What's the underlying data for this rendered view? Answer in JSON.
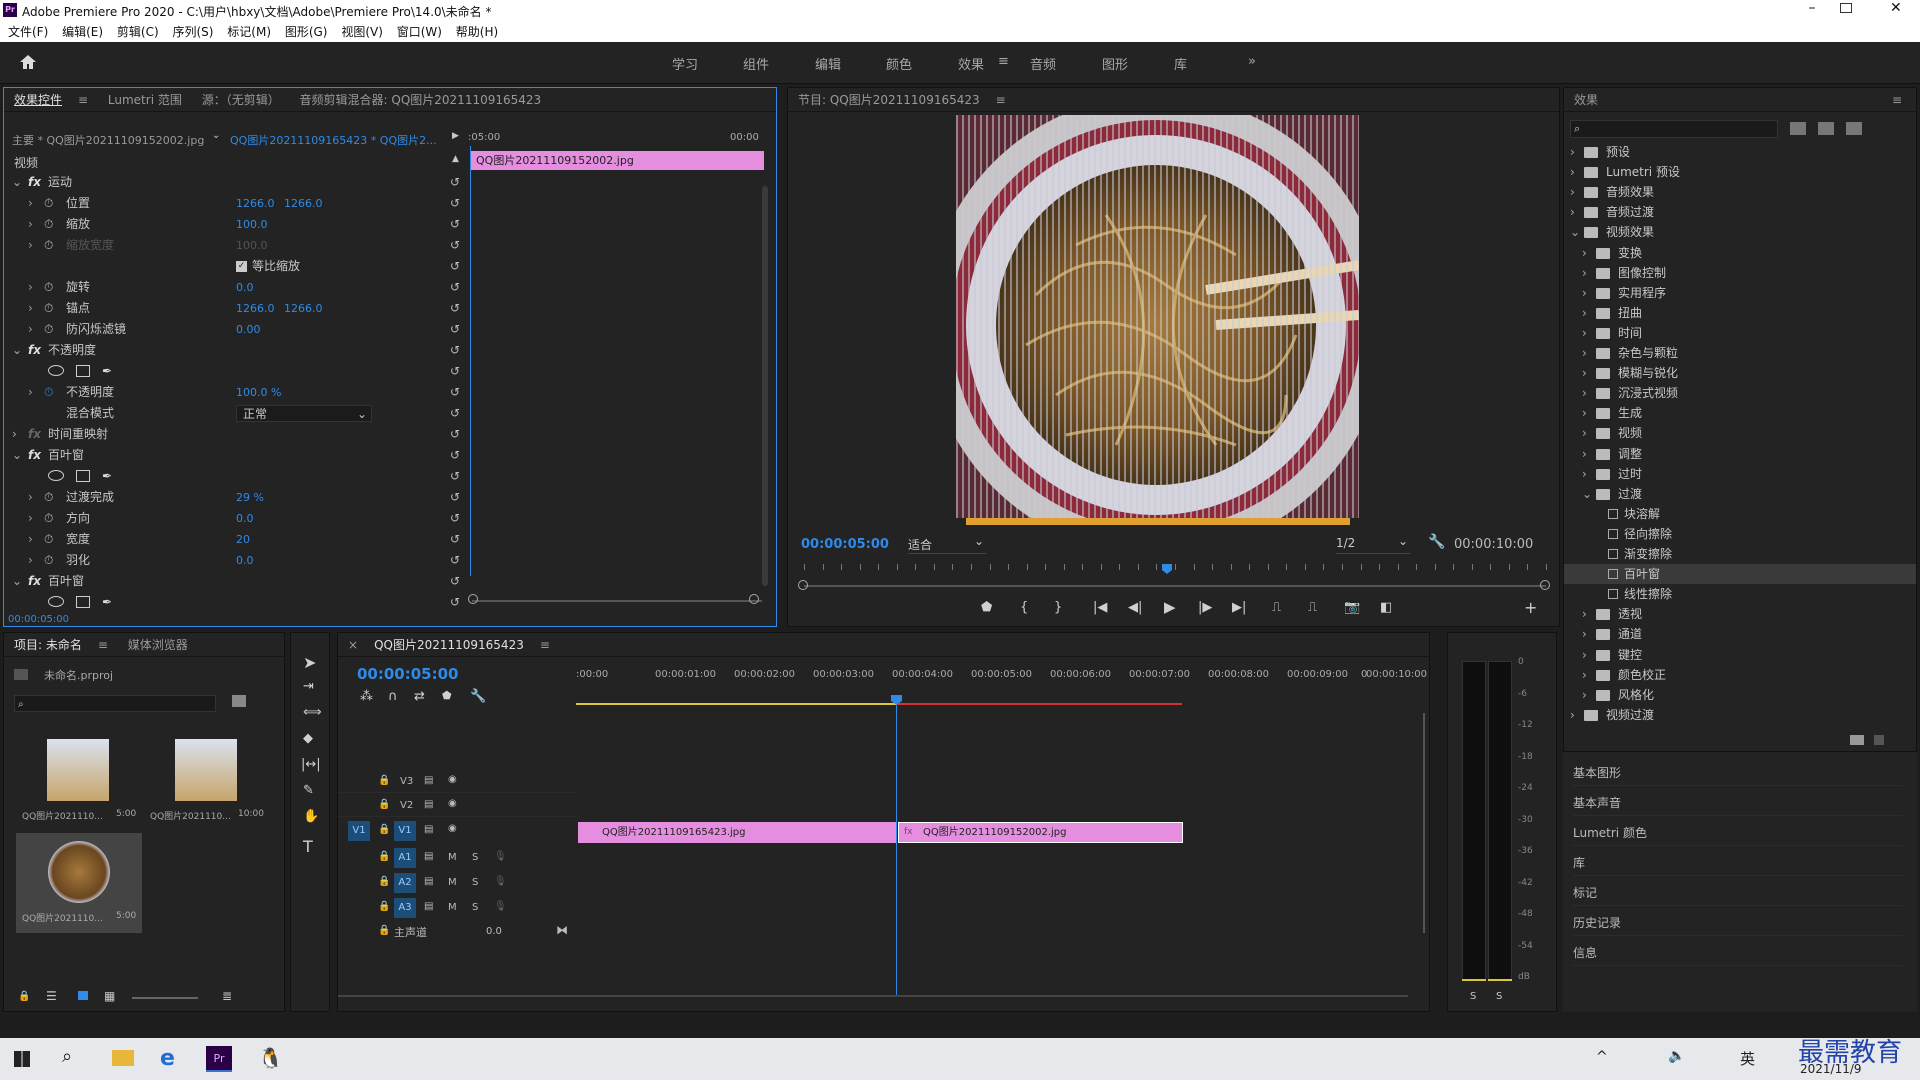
{
  "app": {
    "title": "Adobe Premiere Pro 2020 - C:\\用户\\hbxy\\文档\\Adobe\\Premiere Pro\\14.0\\未命名 *",
    "icon": "Pr"
  },
  "menu": [
    "文件(F)",
    "编辑(E)",
    "剪辑(C)",
    "序列(S)",
    "标记(M)",
    "图形(G)",
    "视图(V)",
    "窗口(W)",
    "帮助(H)"
  ],
  "workspaces": [
    "学习",
    "组件",
    "编辑",
    "颜色",
    "效果",
    "音频",
    "图形",
    "库"
  ],
  "active_workspace": "效果",
  "effect_controls": {
    "tabs": [
      "效果控件",
      "Lumetri 范围",
      "源：（无剪辑）",
      "音频剪辑混合器: QQ图片20211109165423"
    ],
    "master": "主要 * QQ图片20211109152002.jpg",
    "sequence_clip": "QQ图片20211109165423 * QQ图片2...",
    "timecode_start": "00:00",
    "timecode_mid": ":05:00",
    "timecode_end": "00:00",
    "clip_bar_label": "QQ图片20211109152002.jpg",
    "section_video": "视频",
    "rows": [
      {
        "name": "运动",
        "kind": "fx"
      },
      {
        "name": "位置",
        "v1": "1266.0",
        "v2": "1266.0"
      },
      {
        "name": "缩放",
        "v1": "100.0"
      },
      {
        "name": "缩放宽度",
        "v1": "100.0",
        "disabled": true
      },
      {
        "name": "等比缩放",
        "kind": "check"
      },
      {
        "name": "旋转",
        "v1": "0.0"
      },
      {
        "name": "锚点",
        "v1": "1266.0",
        "v2": "1266.0"
      },
      {
        "name": "防闪烁滤镜",
        "v1": "0.00"
      },
      {
        "name": "不透明度",
        "kind": "fx"
      },
      {
        "name": "",
        "kind": "masks"
      },
      {
        "name": "不透明度",
        "v1": "100.0 %"
      },
      {
        "name": "混合模式",
        "kind": "select",
        "v1": "正常"
      },
      {
        "name": "时间重映射",
        "kind": "fx-off"
      },
      {
        "name": "百叶窗",
        "kind": "fx"
      },
      {
        "name": "",
        "kind": "masks"
      },
      {
        "name": "过渡完成",
        "v1": "29 %"
      },
      {
        "name": "方向",
        "v1": "0.0"
      },
      {
        "name": "宽度",
        "v1": "20"
      },
      {
        "name": "羽化",
        "v1": "0.0"
      },
      {
        "name": "百叶窗",
        "kind": "fx"
      },
      {
        "name": "",
        "kind": "masks"
      }
    ],
    "footer_time": "00:00:05:00"
  },
  "program": {
    "title": "节目: QQ图片20211109165423",
    "timecode": "00:00:05:00",
    "fit": "适合",
    "resolution": "1/2",
    "duration": "00:00:10:00",
    "playhead_fraction": 0.5
  },
  "project": {
    "tabs": [
      "项目: 未命名",
      "媒体浏览器"
    ],
    "file": "未命名.prproj",
    "items": [
      {
        "name": "QQ图片2021110...",
        "dur": "5:00"
      },
      {
        "name": "QQ图片2021110...",
        "dur": "10:00"
      },
      {
        "name": "QQ图片2021110...",
        "dur": "5:00"
      }
    ]
  },
  "timeline": {
    "tab": "QQ图片20211109165423",
    "timecode": "00:00:05:00",
    "ruler": [
      ":00:00",
      "00:00:01:00",
      "00:00:02:00",
      "00:00:03:00",
      "00:00:04:00",
      "00:00:05:00",
      "00:00:06:00",
      "00:00:07:00",
      "00:00:08:00",
      "00:00:09:00",
      "00:00:10:00",
      "0"
    ],
    "tracks_video": [
      "V3",
      "V2",
      "V1"
    ],
    "tracks_audio": [
      "A1",
      "A2",
      "A3"
    ],
    "master": "主声道",
    "master_val": "0.0",
    "clip1": "QQ图片20211109165423.jpg",
    "clip2": "QQ图片20211109152002.jpg",
    "source_patch": "V1"
  },
  "meter": {
    "labels": [
      "0",
      "-6",
      "-12",
      "-18",
      "-24",
      "-30",
      "-36",
      "-42",
      "-48",
      "-54",
      "dB"
    ],
    "solo": [
      "S",
      "S"
    ]
  },
  "effects_panel": {
    "title": "效果",
    "tree": [
      {
        "label": "预设",
        "level": 0,
        "open": false
      },
      {
        "label": "Lumetri 预设",
        "level": 0,
        "open": false
      },
      {
        "label": "音频效果",
        "level": 0,
        "open": false
      },
      {
        "label": "音频过渡",
        "level": 0,
        "open": false
      },
      {
        "label": "视频效果",
        "level": 0,
        "open": true
      },
      {
        "label": "变换",
        "level": 1
      },
      {
        "label": "图像控制",
        "level": 1
      },
      {
        "label": "实用程序",
        "level": 1
      },
      {
        "label": "扭曲",
        "level": 1
      },
      {
        "label": "时间",
        "level": 1
      },
      {
        "label": "杂色与颗粒",
        "level": 1
      },
      {
        "label": "模糊与锐化",
        "level": 1
      },
      {
        "label": "沉浸式视频",
        "level": 1
      },
      {
        "label": "生成",
        "level": 1
      },
      {
        "label": "视频",
        "level": 1
      },
      {
        "label": "调整",
        "level": 1
      },
      {
        "label": "过时",
        "level": 1
      },
      {
        "label": "过渡",
        "level": 1,
        "open": true
      },
      {
        "label": "块溶解",
        "level": 2
      },
      {
        "label": "径向擦除",
        "level": 2
      },
      {
        "label": "渐变擦除",
        "level": 2
      },
      {
        "label": "百叶窗",
        "level": 2,
        "selected": true
      },
      {
        "label": "线性擦除",
        "level": 2
      },
      {
        "label": "透视",
        "level": 1
      },
      {
        "label": "通道",
        "level": 1
      },
      {
        "label": "键控",
        "level": 1
      },
      {
        "label": "颜色校正",
        "level": 1
      },
      {
        "label": "风格化",
        "level": 1
      },
      {
        "label": "视频过渡",
        "level": 0,
        "open": false
      }
    ],
    "collapsed_panels": [
      "基本图形",
      "基本声音",
      "Lumetri 颜色",
      "库",
      "标记",
      "历史记录",
      "信息"
    ]
  },
  "taskbar": {
    "ime": "英",
    "date": "2021/11/9",
    "watermark": "最需教育"
  },
  "colors": {
    "accent": "#2e8bea",
    "clip": "#e58ee0",
    "playhead": "#2e8bea",
    "render_bar_red": "#d63333",
    "render_bar_yellow": "#d8c73a"
  }
}
